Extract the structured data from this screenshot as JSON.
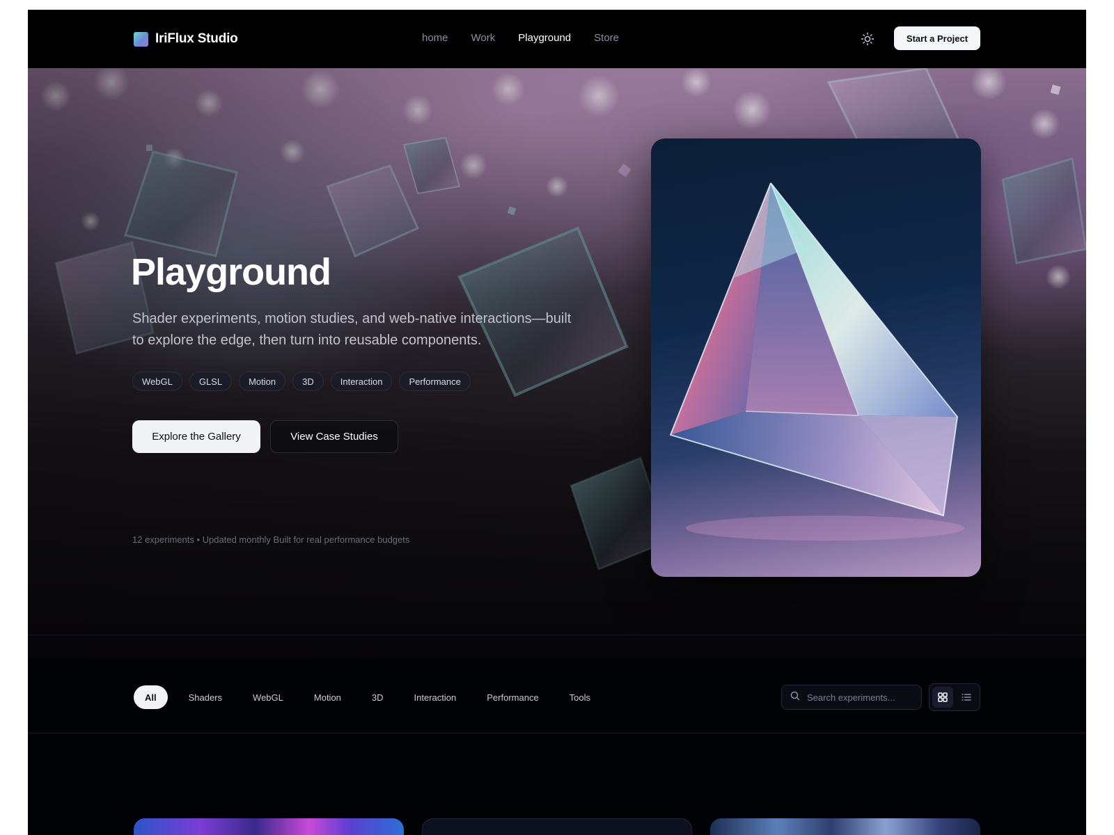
{
  "brand": {
    "name": "IriFlux Studio"
  },
  "nav": {
    "links": [
      "home",
      "Work",
      "Playground",
      "Store"
    ],
    "active": "Playground",
    "cta_label": "Start a Project"
  },
  "hero": {
    "title": "Playground",
    "subtitle": "Shader experiments, motion studies, and web-native interactions—built to explore the edge, then turn into reusable components.",
    "tags": [
      "WebGL",
      "GLSL",
      "Motion",
      "3D",
      "Interaction",
      "Performance"
    ],
    "primary_button": "Explore the Gallery",
    "secondary_button": "View Case Studies",
    "meta": "12 experiments • Updated monthly Built for real performance budgets"
  },
  "filters": {
    "categories": [
      "All",
      "Shaders",
      "WebGL",
      "Motion",
      "3D",
      "Interaction",
      "Performance",
      "Tools"
    ],
    "active": "All",
    "search_placeholder": "Search experiments...",
    "view_mode": "grid"
  },
  "icons": {
    "theme_toggle": "sun-icon",
    "search": "search-icon",
    "grid_view": "grid-icon",
    "list_view": "list-icon"
  },
  "colors": {
    "background": "#010205",
    "accent_light": "#f2f3f6",
    "brand_gradient": [
      "#6fd6c9",
      "#6a8bd8",
      "#9d79d0"
    ]
  }
}
